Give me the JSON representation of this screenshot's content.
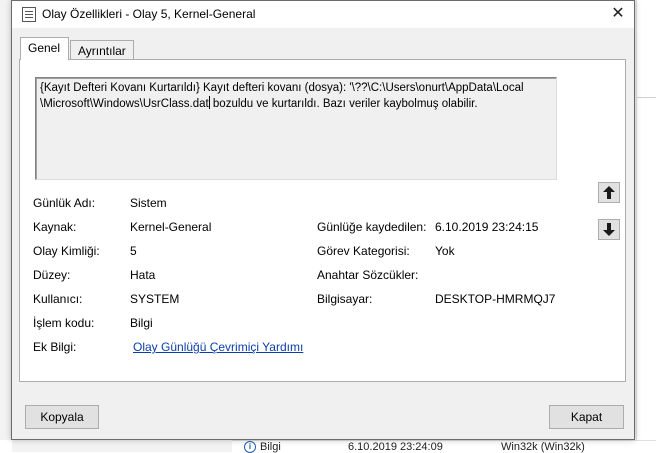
{
  "window": {
    "title": "Olay Özellikleri - Olay 5, Kernel-General",
    "close_glyph": "✕"
  },
  "tabs": [
    {
      "label": "Genel",
      "active": true
    },
    {
      "label": "Ayrıntılar",
      "active": false
    }
  ],
  "message": {
    "line1": "{Kayıt Defteri Kovanı Kurtarıldı} Kayıt defteri kovanı (dosya): '\\??\\C:\\Users\\onurt\\AppData\\Local",
    "line2a": "\\Microsoft\\Windows\\UsrClass.dat",
    "line2b": " bozuldu ve kurtarıldı. Bazı veriler kaybolmuş olabilir."
  },
  "fields": {
    "log_name": {
      "label": "Günlük Adı:",
      "value": "Sistem"
    },
    "source": {
      "label": "Kaynak:",
      "value": "Kernel-General"
    },
    "logged": {
      "label": "Günlüğe kaydedilen:",
      "value": "6.10.2019 23:24:15"
    },
    "event_id": {
      "label": "Olay Kimliği:",
      "value": "5"
    },
    "task_category": {
      "label": "Görev Kategorisi:",
      "value": "Yok"
    },
    "level": {
      "label": "Düzey:",
      "value": "Hata"
    },
    "keywords": {
      "label": "Anahtar Sözcükler:",
      "value": ""
    },
    "user": {
      "label": "Kullanıcı:",
      "value": "SYSTEM"
    },
    "computer": {
      "label": "Bilgisayar:",
      "value": "DESKTOP-HMRMQJ7"
    },
    "opcode": {
      "label": "İşlem kodu:",
      "value": "Bilgi"
    },
    "more_info": {
      "label": "Ek Bilgi:",
      "link": "Olay Günlüğü Çevrimiçi Yardımı"
    }
  },
  "buttons": {
    "copy": "Kopyala",
    "close": "Kapat"
  },
  "background_row": {
    "level": "Bilgi",
    "date": "6.10.2019 23:24:09",
    "source": "Win32k (Win32k)"
  },
  "icons": {
    "app": "event-properties-icon",
    "up": "arrow-up-icon",
    "down": "arrow-down-icon",
    "info": "info-icon"
  },
  "colors": {
    "link": "#0b3ea8",
    "dialog_bg": "#f0f0f0",
    "panel_bg": "#ffffff"
  }
}
